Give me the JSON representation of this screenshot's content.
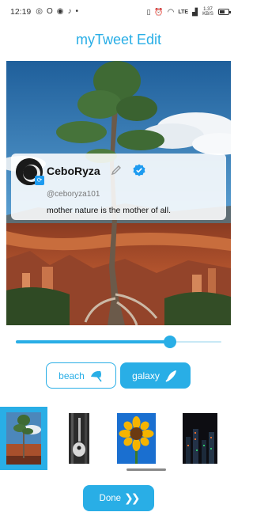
{
  "status_bar": {
    "time": "12:19",
    "network": "LTE",
    "speed": "1.37 KB/S",
    "battery_level": 0.6
  },
  "app": {
    "title": "myTweet Edit"
  },
  "tweet": {
    "name": "CeboRyza",
    "handle": "@ceboryza101",
    "text": "mother nature is the mother of all."
  },
  "slider": {
    "value": 0.75
  },
  "backgrounds": [
    {
      "label": "beach",
      "icon": "umbrella-icon",
      "selected": false
    },
    {
      "label": "galaxy",
      "icon": "rocket-icon",
      "selected": true
    }
  ],
  "thumbnails": [
    {
      "name": "tree-thumbnail",
      "selected": true
    },
    {
      "name": "guitar-thumbnail",
      "selected": false
    },
    {
      "name": "sunflower-thumbnail",
      "selected": false
    },
    {
      "name": "city-night-thumbnail",
      "selected": false
    }
  ],
  "done_button": {
    "label": "Done"
  },
  "colors": {
    "accent": "#29aee6",
    "title": "#29aee6"
  }
}
